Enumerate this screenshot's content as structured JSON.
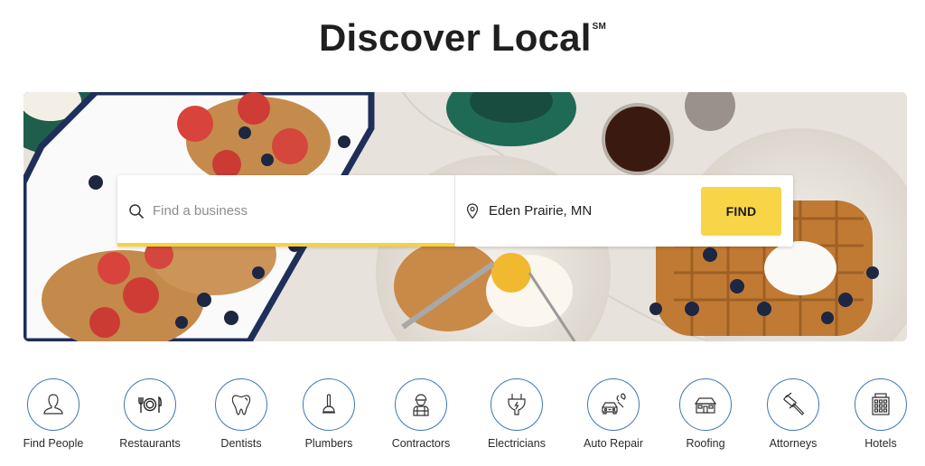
{
  "header": {
    "title": "Discover Local",
    "service_mark": "SM"
  },
  "search": {
    "what_placeholder": "Find a business",
    "what_value": "",
    "where_value": "Eden Prairie, MN",
    "find_label": "FIND",
    "accent_color": "#f6d23c",
    "button_color": "#f7d547"
  },
  "categories": [
    {
      "label": "Find People",
      "icon": "person-icon"
    },
    {
      "label": "Restaurants",
      "icon": "fork-plate-knife-icon"
    },
    {
      "label": "Dentists",
      "icon": "tooth-icon"
    },
    {
      "label": "Plumbers",
      "icon": "plunger-icon"
    },
    {
      "label": "Contractors",
      "icon": "construction-worker-icon"
    },
    {
      "label": "Electricians",
      "icon": "electric-plug-icon"
    },
    {
      "label": "Auto Repair",
      "icon": "car-wrench-icon"
    },
    {
      "label": "Roofing",
      "icon": "house-icon"
    },
    {
      "label": "Attorneys",
      "icon": "gavel-icon"
    },
    {
      "label": "Hotels",
      "icon": "hotel-building-icon"
    }
  ],
  "colors": {
    "category_ring": "#3a78b7",
    "text": "#1f1f1f"
  }
}
